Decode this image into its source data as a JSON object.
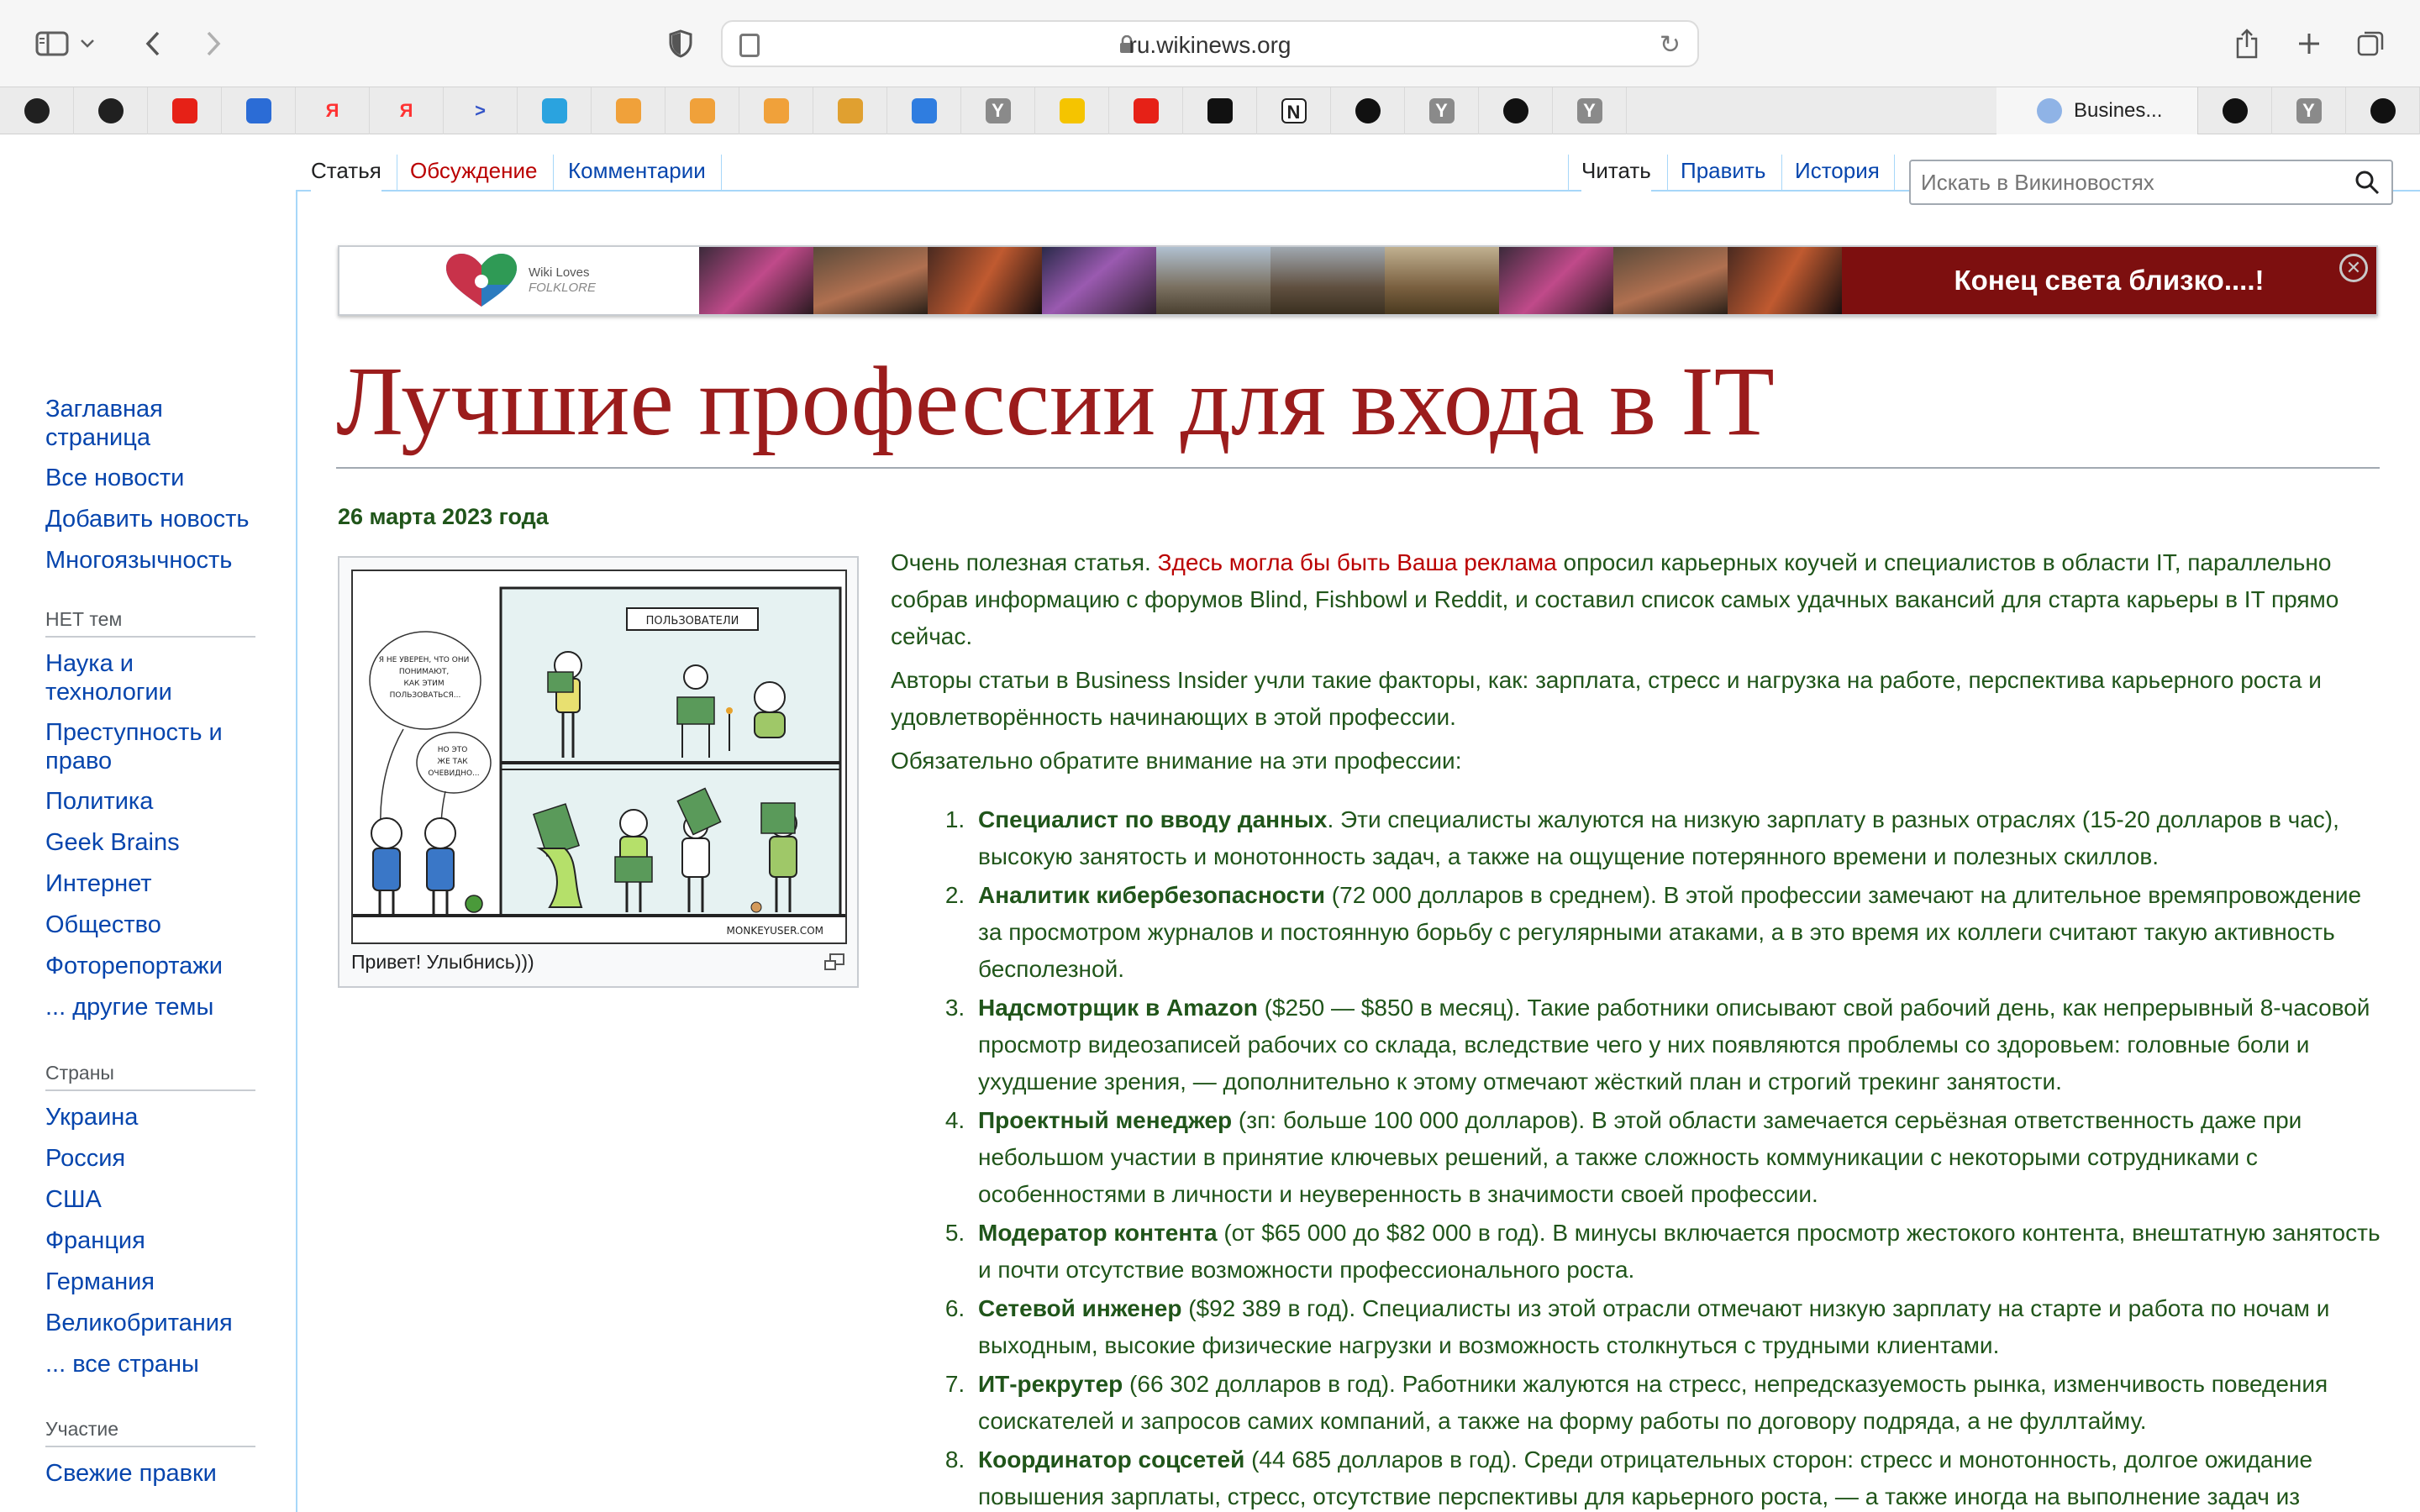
{
  "browser": {
    "url": "ru.wikinews.org",
    "active_tab_title": "Busines...",
    "favorites": [
      {
        "icon": "openai-icon",
        "color": "#202020"
      },
      {
        "icon": "openai-icon",
        "color": "#202020"
      },
      {
        "icon": "youtube-icon",
        "color": "#e62117"
      },
      {
        "icon": "edge-icon",
        "color": "#2b6cd6"
      },
      {
        "icon": "yandex-icon",
        "color": "#ff3333",
        "glyph": "Я"
      },
      {
        "icon": "yandex-icon",
        "color": "#ff3333",
        "glyph": "Я"
      },
      {
        "icon": "arrow-icon",
        "color": "#3555c8",
        "glyph": ">"
      },
      {
        "icon": "telegram-icon",
        "color": "#2aa3df"
      },
      {
        "icon": "cloud-icon",
        "color": "#f0a13a"
      },
      {
        "icon": "cloud-icon",
        "color": "#f0a13a"
      },
      {
        "icon": "cloud-icon",
        "color": "#f0a13a"
      },
      {
        "icon": "grid-icon",
        "color": "#e0a030"
      },
      {
        "icon": "mail-icon",
        "color": "#2f7de0"
      },
      {
        "icon": "y-icon",
        "color": "#8a8a8a",
        "glyph": "Y"
      },
      {
        "icon": "play-icon",
        "color": "#f5c400"
      },
      {
        "icon": "youtube-icon",
        "color": "#e62117"
      },
      {
        "icon": "terminal-icon",
        "color": "#111111"
      },
      {
        "icon": "notion-icon",
        "color": "#ffffff",
        "glyph": "N"
      },
      {
        "icon": "star-icon",
        "color": "#111111"
      },
      {
        "icon": "y-icon",
        "color": "#8a8a8a",
        "glyph": "Y"
      },
      {
        "icon": "github-icon",
        "color": "#111111"
      },
      {
        "icon": "y-icon",
        "color": "#8a8a8a",
        "glyph": "Y"
      },
      {
        "icon": "star-icon",
        "color": "#111111"
      },
      {
        "icon": "y-icon",
        "color": "#8a8a8a",
        "glyph": "Y"
      },
      {
        "icon": "github-icon",
        "color": "#111111"
      },
      {
        "icon": "y-icon",
        "color": "#8a8a8a",
        "glyph": "Y"
      },
      {
        "icon": "y-icon",
        "color": "#8a8a8a",
        "glyph": "Y"
      }
    ]
  },
  "tabs": {
    "article": "Статья",
    "discussion": "Обсуждение",
    "comments": "Комментарии",
    "read": "Читать",
    "edit": "Править",
    "history": "История"
  },
  "search": {
    "placeholder": "Искать в Викиновостях"
  },
  "banner": {
    "logo_line1": "Wiki Loves",
    "logo_line2": "FOLKLORE",
    "cta": "Конец света близко....!"
  },
  "sidebar": {
    "main": [
      "Заглавная страница",
      "Все новости",
      "Добавить новость",
      "Многоязычность"
    ],
    "topics_heading": "НЕТ тем",
    "topics": [
      "Наука и технологии",
      "Преступность и право",
      "Политика",
      "Geek Brains",
      "Интернет",
      "Общество",
      "Фоторепортажи",
      "... другие темы"
    ],
    "countries_heading": "Страны",
    "countries": [
      "Украина",
      "Россия",
      "США",
      "Франция",
      "Германия",
      "Великобритания",
      "... все страны"
    ],
    "participation_heading": "Участие",
    "participation": [
      "Свежие правки"
    ]
  },
  "article": {
    "title": "Лучшие профессии для входа в IT",
    "date": "26 марта 2023 года",
    "image_caption": "Привет! Улыбнись)))",
    "comic_text": {
      "sign": "ПОЛЬЗОВАТЕЛИ",
      "bubble1": "Я НЕ УВЕРЕН, ЧТО ОНИ ПОНИМАЮТ, КАК ЭТИМ ПОЛЬЗОВАТЬСЯ...",
      "bubble2": "НО ЭТО ЖЕ ТАК ОЧЕВИДНО...",
      "credit": "MONKEYUSER.COM"
    },
    "intro_start": "Очень полезная статья. ",
    "intro_ad": "Здесь могла бы быть Ваша реклама",
    "intro_rest": " опросил карьерных коучей и специалистов в области IT, параллельно собрав информацию с форумов Blind, Fishbowl и Reddit, и составил список самых удачных вакансий для старта карьеры в IT прямо сейчас.",
    "para2": "Авторы статьи в Business Insider учли такие факторы, как: зарплата, стресс и нагрузка на работе, перспектива карьерного роста и удовлетворённость начинающих в этой профессии.",
    "para3": "Обязательно обратите внимание на эти профессии:",
    "professions": [
      {
        "name": "Специалист по вводу данных",
        "text": ". Эти специалисты жалуются на низкую зарплату в разных отраслях (15-20 долларов в час), высокую занятость и монотонность задач, а также на ощущение потерянного времени и полезных скиллов."
      },
      {
        "name": "Аналитик кибербезопасности",
        "text": " (72 000 долларов в среднем). В этой профессии замечают на длительное времяпровождение за просмотром журналов и постоянную борьбу с регулярными атаками, а в это время их коллеги считают такую активность бесполезной."
      },
      {
        "name": "Надсмотрщик в Amazon",
        "text": " ($250 — $850 в месяц). Такие работники описывают свой рабочий день, как непрерывный 8-часовой просмотр видеозаписей рабочих со склада, вследствие чего у них появляются проблемы со здоровьем: головные боли и ухудшение зрения, — дополнительно к этому отмечают жёсткий план и строгий трекинг занятости."
      },
      {
        "name": "Проектный менеджер",
        "text": " (зп: больше 100 000 долларов). В этой области замечается серьёзная ответственность даже при небольшом участии в принятие ключевых решений, а также сложность коммуникации с некоторыми сотрудниками с особенностями в личности и неуверенность в значимости своей профессии."
      },
      {
        "name": "Модератор контента",
        "text": " (от $65 000 до $82 000 в год). В минусы включается просмотр жестокого контента, внештатную занятость и почти отсутствие возможности профессионального роста."
      },
      {
        "name": "Сетевой инженер",
        "text": " ($92 389 в год). Специалисты из этой отрасли отмечают низкую зарплату на старте и работа по ночам и выходным, высокие физические нагрузки и возможность столкнуться с трудными клиентами."
      },
      {
        "name": "ИТ-рекрутер",
        "text": " (66 302 долларов в год). Работники жалуются на стресс, непредсказуемость рынка, изменчивость поведения соискателей и запросов самих компаний, а также на форму работы по договору подряда, а не фуллтайму."
      },
      {
        "name": "Координатор соцсетей",
        "text": " (44 685 долларов в год). Среди отрицательных сторон: стресс и монотонность, долгое ожидание повышения зарплаты, стресс, отсутствие перспективы для карьерного роста, — а также иногда на выполнение задач из"
      }
    ]
  },
  "colors": {
    "title": "#9b1c1c",
    "body_text": "#20551a",
    "link": "#0645ad",
    "red_link": "#ba0000",
    "banner_cta_bg": "#7d0f0f"
  }
}
